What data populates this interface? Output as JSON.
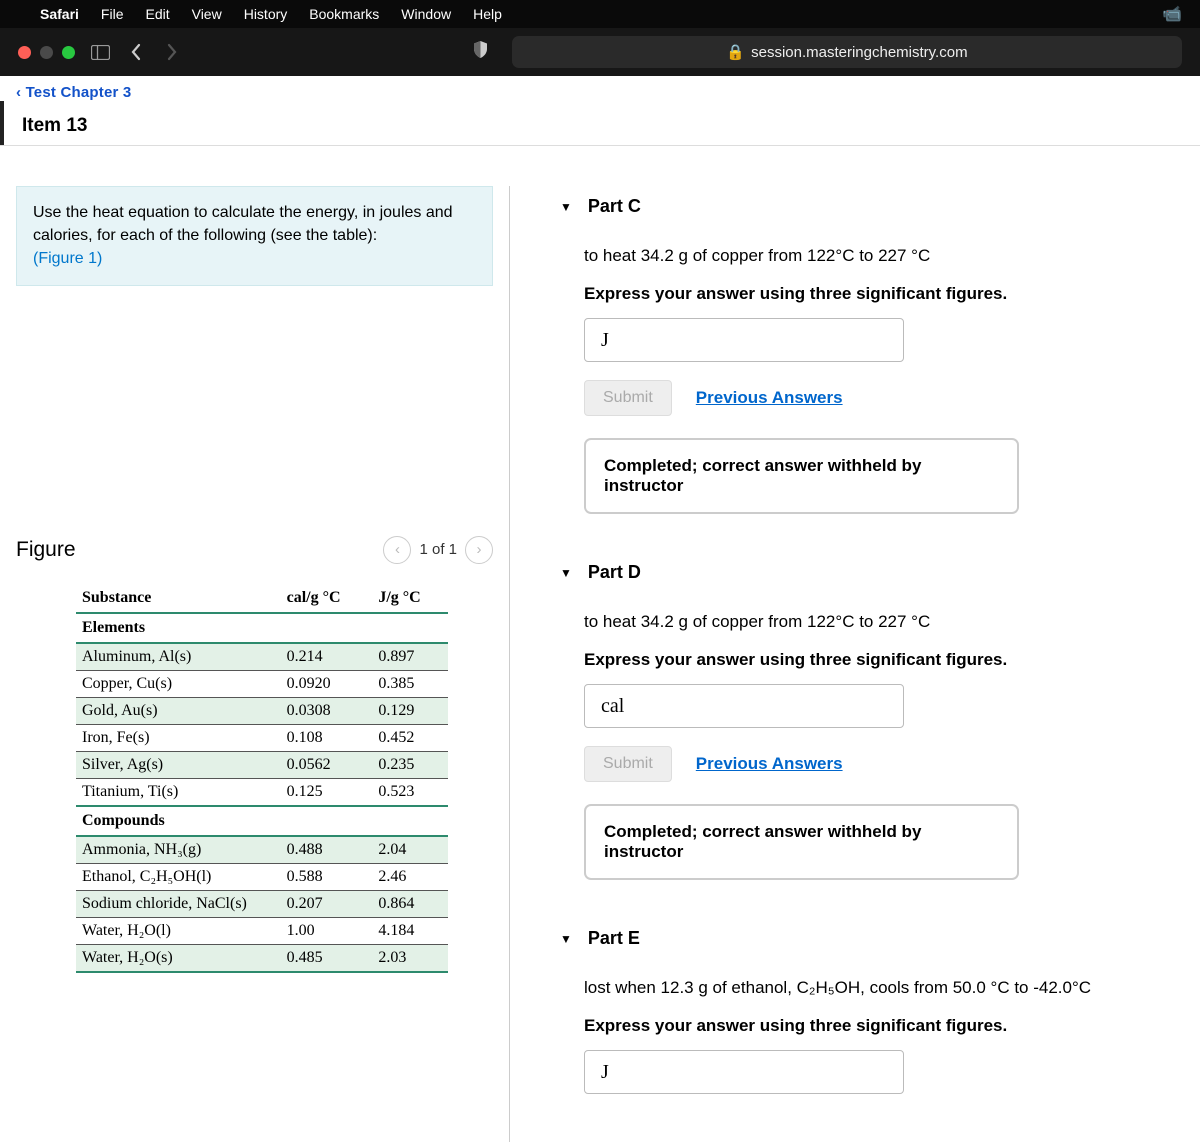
{
  "menubar": {
    "app": "Safari",
    "items": [
      "File",
      "Edit",
      "View",
      "History",
      "Bookmarks",
      "Window",
      "Help"
    ]
  },
  "url": "session.masteringchemistry.com",
  "breadcrumb": "‹ Test Chapter 3",
  "item_title": "Item 13",
  "prompt": {
    "line1": "Use the heat equation to calculate the energy, in joules and calories, for each of the following (see the table):",
    "figlink": "(Figure 1)"
  },
  "figure": {
    "title": "Figure",
    "pager": "1 of 1",
    "headers": [
      "Substance",
      "cal/g °C",
      "J/g °C"
    ],
    "sections": [
      {
        "name": "Elements",
        "rows": [
          {
            "s": "Aluminum, Al(s)",
            "c": "0.214",
            "j": "0.897",
            "alt": true
          },
          {
            "s": "Copper, Cu(s)",
            "c": "0.0920",
            "j": "0.385"
          },
          {
            "s": "Gold, Au(s)",
            "c": "0.0308",
            "j": "0.129",
            "alt": true
          },
          {
            "s": "Iron, Fe(s)",
            "c": "0.108",
            "j": "0.452"
          },
          {
            "s": "Silver, Ag(s)",
            "c": "0.0562",
            "j": "0.235",
            "alt": true
          },
          {
            "s": "Titanium, Ti(s)",
            "c": "0.125",
            "j": "0.523",
            "last": true
          }
        ]
      },
      {
        "name": "Compounds",
        "rows": [
          {
            "s": "Ammonia, NH₃(g)",
            "c": "0.488",
            "j": "2.04",
            "alt": true
          },
          {
            "s": "Ethanol, C₂H₅OH(l)",
            "c": "0.588",
            "j": "2.46"
          },
          {
            "s": "Sodium chloride, NaCl(s)",
            "c": "0.207",
            "j": "0.864",
            "alt": true
          },
          {
            "s": "Water, H₂O(l)",
            "c": "1.00",
            "j": "4.184"
          },
          {
            "s": "Water, H₂O(s)",
            "c": "0.485",
            "j": "2.03",
            "alt": true,
            "last": true
          }
        ]
      }
    ]
  },
  "parts": [
    {
      "id": "C",
      "title": "Part C",
      "question": "to heat 34.2 g of copper from 122°C to 227 °C",
      "hint": "Express your answer using three significant figures.",
      "unit": "J",
      "submit": "Submit",
      "prev": "Previous Answers",
      "status": "Completed; correct answer withheld by instructor"
    },
    {
      "id": "D",
      "title": "Part D",
      "question": "to heat 34.2 g of copper from 122°C to 227 °C",
      "hint": "Express your answer using three significant figures.",
      "unit": "cal",
      "submit": "Submit",
      "prev": "Previous Answers",
      "status": "Completed; correct answer withheld by instructor"
    },
    {
      "id": "E",
      "title": "Part E",
      "question": "lost when 12.3 g of ethanol, C₂H₅OH, cools from 50.0 °C to -42.0°C",
      "hint": "Express your answer using three significant figures.",
      "unit": "J"
    }
  ]
}
